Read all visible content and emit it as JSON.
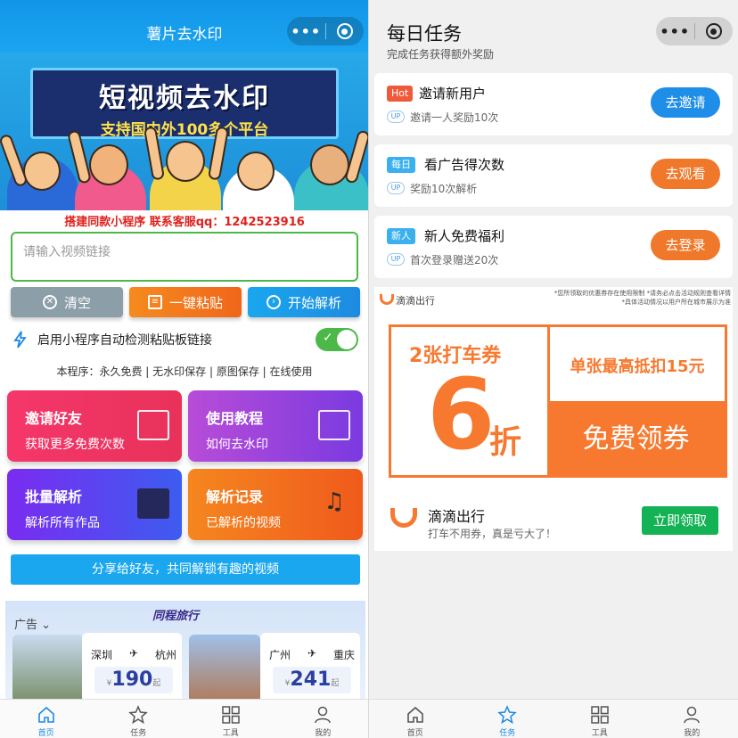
{
  "left": {
    "title": "薯片去水印",
    "capsule": {
      "more": "•••"
    },
    "banner": {
      "headline": "短视频去水印",
      "subline": "支持国内外100多个平台"
    },
    "contact": "搭建同款小程序 联系客服qq：1242523916",
    "input": {
      "placeholder": "请输入视频链接"
    },
    "buttons": {
      "clear": "清空",
      "paste": "一键粘贴",
      "parse": "开始解析"
    },
    "auto_detect": {
      "label": "启用小程序自动检测粘贴板链接",
      "enabled": true
    },
    "features": "本程序：永久免费 | 无水印保存 | 原图保存 | 在线使用",
    "cards": [
      {
        "title": "邀请好友",
        "sub": "获取更多免费次数"
      },
      {
        "title": "使用教程",
        "sub": "如何去水印"
      },
      {
        "title": "批量解析",
        "sub": "解析所有作品"
      },
      {
        "title": "解析记录",
        "sub": "已解析的视频"
      }
    ],
    "share": "分享给好友，共同解锁有趣的视频",
    "ad": {
      "label": "广告",
      "brand": "同程旅行",
      "flights": [
        {
          "from": "深圳",
          "to": "杭州",
          "currency": "¥",
          "price": "190",
          "suffix": "起"
        },
        {
          "from": "广州",
          "to": "重庆",
          "currency": "¥",
          "price": "241",
          "suffix": "起"
        }
      ]
    }
  },
  "right": {
    "title": "每日任务",
    "subtitle": "完成任务获得额外奖励",
    "tasks": [
      {
        "tag": "Hot",
        "tag_color": "#f05a3c",
        "title": "邀请新用户",
        "badge": "UP",
        "sub": "邀请一人奖励10次",
        "button": "去邀请",
        "button_color": "#1e8ee8"
      },
      {
        "tag": "每日",
        "tag_color": "#3bb0ee",
        "title": "看广告得次数",
        "badge": "UP",
        "sub": "奖励10次解析",
        "button": "去观看",
        "button_color": "#f0782a"
      },
      {
        "tag": "新人",
        "tag_color": "#3bb0ee",
        "title": "新人免费福利",
        "badge": "UP",
        "sub": "首次登录赠送20次",
        "button": "去登录",
        "button_color": "#f0782a"
      }
    ],
    "didi": {
      "small_name": "滴滴出行",
      "note_line1": "*您所领取的优惠券存在使用限制 *请务必点击活动规则查看详情",
      "note_line2": "*具体活动情况以用户所在城市展示为准",
      "coupon_count": "2张打车券",
      "discount": "6",
      "discount_unit": "折",
      "max_deduct": "单张最高抵扣15元",
      "free": "免费领券",
      "brand": "滴滴出行",
      "slogan": "打车不用券，真是亏大了！",
      "claim": "立即领取"
    }
  },
  "tabbar": [
    {
      "label": "首页",
      "icon": "home-icon"
    },
    {
      "label": "任务",
      "icon": "star-icon"
    },
    {
      "label": "工具",
      "icon": "grid-icon"
    },
    {
      "label": "我的",
      "icon": "user-icon"
    }
  ],
  "colors": {
    "accent": "#1a8ae6",
    "didi_orange": "#f7792f",
    "green": "#13b255"
  }
}
